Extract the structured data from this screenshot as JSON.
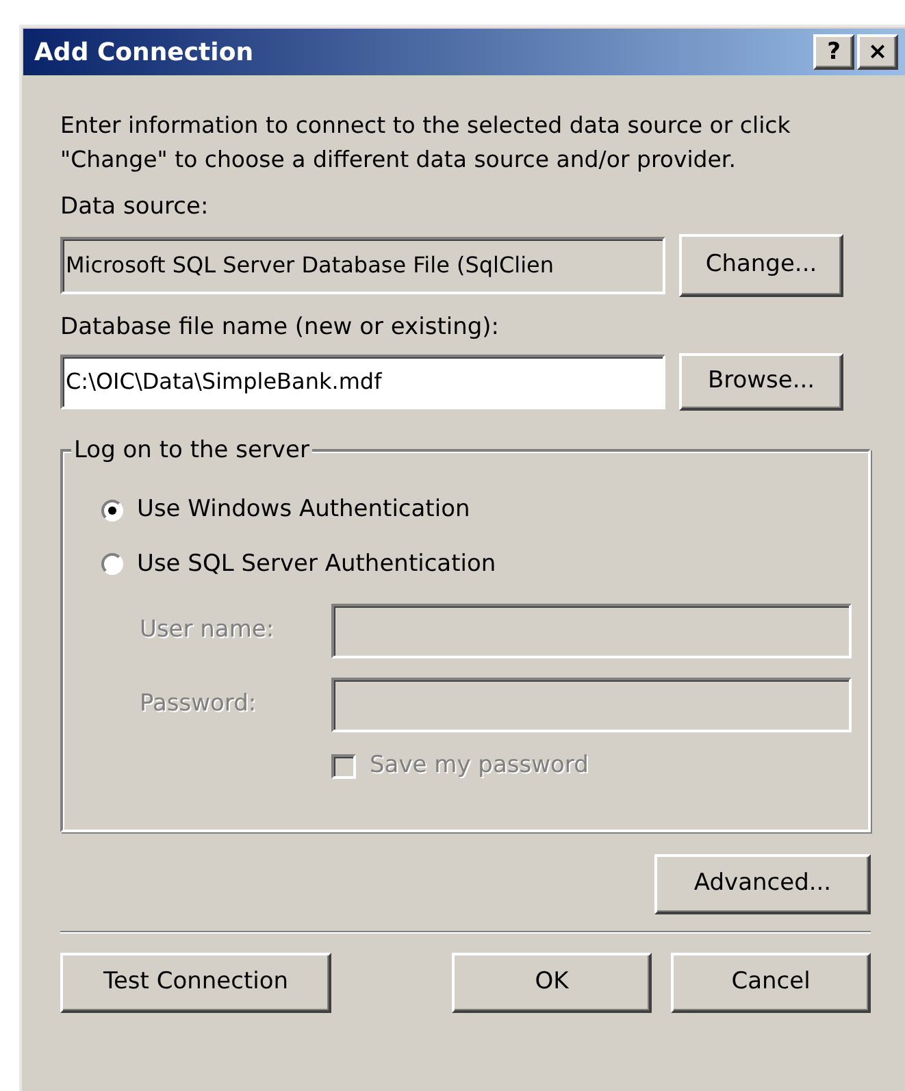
{
  "window": {
    "title": "Add Connection",
    "title_buttons": [
      "?",
      "×"
    ]
  },
  "intro": "Enter information to connect to the selected data source or click \"Change\" to choose a different data source and/or provider.",
  "data_source": {
    "label": "Data source:",
    "value": "Microsoft SQL Server Database File (SqlClien",
    "button": "Change..."
  },
  "database_file": {
    "label": "Database file name (new or existing):",
    "value": "C:\\OIC\\Data\\SimpleBank.mdf",
    "button": "Browse..."
  },
  "logon": {
    "title": "Log on to the server",
    "options": [
      {
        "label": "Use Windows Authentication",
        "selected": true
      },
      {
        "label": "Use SQL Server Authentication",
        "selected": false
      }
    ],
    "fields": [
      {
        "label": "User name:",
        "disabled": true
      },
      {
        "label": "Password:",
        "disabled": true
      }
    ],
    "save_password": {
      "label": "Save my password",
      "checked": false,
      "disabled": true
    }
  },
  "advanced_button": "Advanced...",
  "buttons": [
    "Test Connection",
    "OK",
    "Cancel"
  ]
}
